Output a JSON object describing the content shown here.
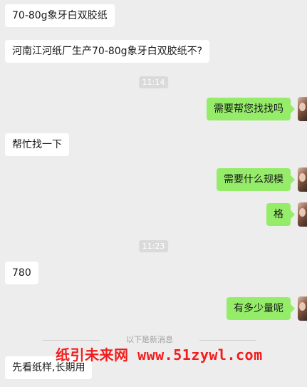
{
  "messages": [
    {
      "side": "left",
      "text": "70-80g象牙白双胶纸"
    },
    {
      "side": "left",
      "text": "河南江河纸厂生产70-80g象牙白双胶纸不?"
    },
    {
      "side": "time",
      "text": "11:14"
    },
    {
      "side": "right",
      "text": "需要帮您找找吗"
    },
    {
      "side": "left",
      "text": "帮忙找一下"
    },
    {
      "side": "right",
      "text": "需要什么规模"
    },
    {
      "side": "right",
      "text": "格"
    },
    {
      "side": "time",
      "text": "11:23"
    },
    {
      "side": "left",
      "text": "780"
    },
    {
      "side": "right",
      "text": "有多少量呢"
    },
    {
      "side": "left",
      "text": "先看纸样,长期用"
    }
  ],
  "new_messages_divider": "以下是新消息",
  "watermark": "纸引未来网 www.51zywl.com",
  "colors": {
    "background": "#ededed",
    "left_bubble": "#ffffff",
    "right_bubble": "#95ec69",
    "watermark": "#f31c1c"
  },
  "icons": {
    "avatar": "user-avatar-photo"
  }
}
